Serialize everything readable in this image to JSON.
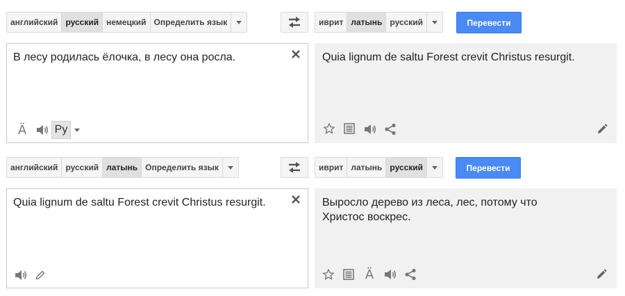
{
  "panel1": {
    "source_langs": [
      {
        "label": "английский",
        "selected": false
      },
      {
        "label": "русский",
        "selected": true
      },
      {
        "label": "немецкий",
        "selected": false
      },
      {
        "label": "Определить язык",
        "selected": false
      }
    ],
    "target_langs": [
      {
        "label": "иврит",
        "selected": false
      },
      {
        "label": "латынь",
        "selected": true
      },
      {
        "label": "русский",
        "selected": false
      }
    ],
    "translate_label": "Перевести",
    "source_text": "В лесу родилась ёлочка, в лесу она росла.",
    "result_text": "Quia lignum de saltu Forest crevit Christus resurgit.",
    "input_tool_label": "Ру"
  },
  "panel2": {
    "source_langs": [
      {
        "label": "английский",
        "selected": false
      },
      {
        "label": "русский",
        "selected": false
      },
      {
        "label": "латынь",
        "selected": true
      },
      {
        "label": "Определить язык",
        "selected": false
      }
    ],
    "target_langs": [
      {
        "label": "иврит",
        "selected": false
      },
      {
        "label": "латынь",
        "selected": false
      },
      {
        "label": "русский",
        "selected": true
      }
    ],
    "translate_label": "Перевести",
    "source_text": "Quia lignum de saltu Forest crevit Christus resurgit.",
    "result_text": "Выросло дерево из леса, лес, потому что Христос воскрес."
  },
  "icons": {
    "transliterate": "Ä",
    "brand_color": "#4a8af4"
  }
}
